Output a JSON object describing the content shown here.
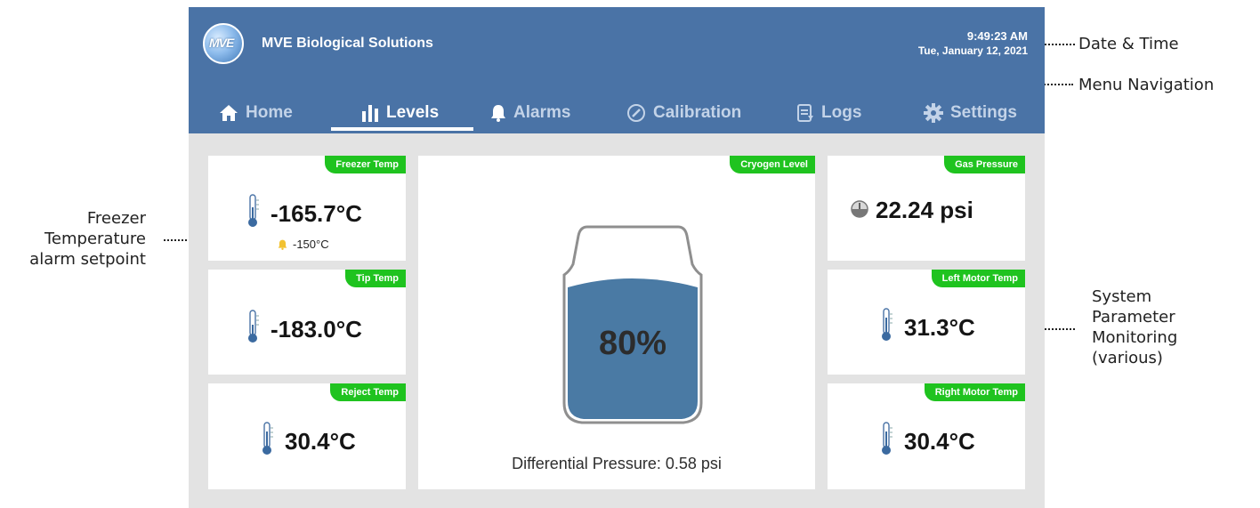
{
  "app": {
    "brand": "MVE Biological Solutions",
    "logo_text": "MVE",
    "time": "9:49:23 AM",
    "date": "Tue, January 12, 2021"
  },
  "nav": {
    "tabs": [
      {
        "label": "Home",
        "icon": "home-icon",
        "active": false
      },
      {
        "label": "Levels",
        "icon": "levels-icon",
        "active": true
      },
      {
        "label": "Alarms",
        "icon": "bell-icon",
        "active": false
      },
      {
        "label": "Calibration",
        "icon": "gauge-icon",
        "active": false
      },
      {
        "label": "Logs",
        "icon": "logs-icon",
        "active": false
      },
      {
        "label": "Settings",
        "icon": "gear-icon",
        "active": false
      }
    ]
  },
  "cards": {
    "freezer_temp": {
      "label": "Freezer Temp",
      "value": "-165.7°C",
      "setpoint": "-150°C",
      "icon": "thermometer-icon"
    },
    "tip_temp": {
      "label": "Tip Temp",
      "value": "-183.0°C",
      "icon": "thermometer-icon"
    },
    "reject_temp": {
      "label": "Reject Temp",
      "value": "30.4°C",
      "icon": "thermometer-icon"
    },
    "cryogen_level": {
      "label": "Cryogen Level",
      "value": "80%",
      "fill_fraction": 0.8,
      "differential_pressure": "Differential Pressure: 0.58 psi"
    },
    "gas_pressure": {
      "label": "Gas Pressure",
      "value": "22.24 psi",
      "icon": "pressure-gauge-icon"
    },
    "left_motor_temp": {
      "label": "Left Motor Temp",
      "value": "31.3°C",
      "icon": "thermometer-icon"
    },
    "right_motor_temp": {
      "label": "Right Motor Temp",
      "value": "30.4°C",
      "icon": "thermometer-icon"
    }
  },
  "annotations": {
    "date_time": "Date & Time",
    "menu_navigation": "Menu Navigation",
    "freezer_alarm_lines": [
      "Freezer",
      "Temperature",
      "alarm setpoint"
    ],
    "system_monitoring_lines": [
      "System",
      "Parameter",
      "Monitoring",
      "(various)"
    ]
  },
  "colors": {
    "header_blue": "#4a73a6",
    "badge_green": "#1fc31f",
    "liquid_blue": "#4a7aa4",
    "alarm_yellow": "#f2c231"
  }
}
